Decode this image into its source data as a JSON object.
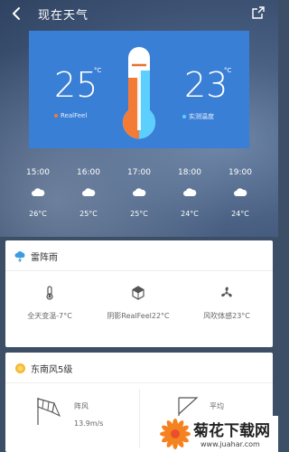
{
  "header": {
    "title": "现在天气",
    "back_icon": "back-arrow-icon",
    "share_icon": "share-icon"
  },
  "current": {
    "realfeel_temp": "25",
    "realfeel_unit": "°C",
    "realfeel_label": "RealFeel",
    "actual_temp": "23",
    "actual_unit": "°C",
    "actual_label": "实测温度",
    "thermometer_icon": "thermometer-icon",
    "colors": {
      "card": "#3a7fd6",
      "realfeel": "#f47b36",
      "actual": "#5ccfff"
    }
  },
  "hourly": [
    {
      "time": "15:00",
      "temp": "26°C",
      "icon": "cloud-icon"
    },
    {
      "time": "16:00",
      "temp": "25°C",
      "icon": "cloud-icon"
    },
    {
      "time": "17:00",
      "temp": "25°C",
      "icon": "cloud-icon"
    },
    {
      "time": "18:00",
      "temp": "24°C",
      "icon": "cloud-icon"
    },
    {
      "time": "19:00",
      "temp": "24°C",
      "icon": "cloud-icon"
    }
  ],
  "condition_card": {
    "title": "雷阵雨",
    "icon": "thunder-rain-icon",
    "metrics": [
      {
        "icon": "thermometer-small-icon",
        "text": "全天变温-7°C"
      },
      {
        "icon": "shade-cube-icon",
        "text": "阴影RealFeel22°C"
      },
      {
        "icon": "fan-icon",
        "text": "风吹体感23°C"
      }
    ]
  },
  "wind_card": {
    "title": "东南风5级",
    "icon": "sun-icon",
    "gust": {
      "icon": "windsock-icon",
      "label": "阵风",
      "value": "13.9m/s"
    },
    "average": {
      "icon": "wind-flag-icon",
      "label": "平均"
    }
  },
  "watermark": {
    "title": "菊花下载网",
    "url": "www.juahar.com",
    "icon": "chrysanthemum-icon"
  }
}
